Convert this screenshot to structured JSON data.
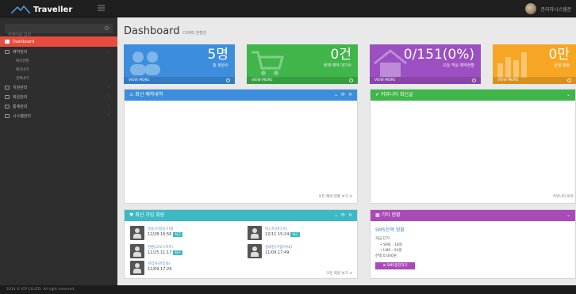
{
  "topbar": {
    "brand": "Traveller",
    "user_name": "관리자시스템관"
  },
  "sidebar": {
    "search_placeholder": "주제어를 입력",
    "items": [
      {
        "label": "Dashboard",
        "icon": "home-icon"
      },
      {
        "label": "예약관리",
        "icon": "calendar-icon"
      },
      {
        "label": "지원관리",
        "icon": "monitor-icon"
      },
      {
        "label": "회원관리",
        "icon": "user-icon"
      },
      {
        "label": "통계관리",
        "icon": "chart-icon"
      },
      {
        "label": "시스템관리",
        "icon": "settings-icon"
      }
    ],
    "subitems": [
      "예약현황",
      "예약내역",
      "결제내역"
    ]
  },
  "page": {
    "title": "Dashboard",
    "subtitle": "CRMS 현황판"
  },
  "stats": [
    {
      "value": "5명",
      "label": "총 회원수",
      "link": "VIEW MORE",
      "color": "#3c8ddc",
      "icon": "users-icon"
    },
    {
      "value": "0건",
      "label": "현재 예약 대기수",
      "link": "VIEW MORE",
      "color": "#3fb54a",
      "icon": "cart-icon"
    },
    {
      "value": "0/151(0%)",
      "label": "오늘 객실 예약현황",
      "link": "VIEW MORE",
      "color": "#9c4fc0",
      "icon": "house-icon"
    },
    {
      "value": "0만",
      "label": "금월 매출",
      "link": "VIEW MORE",
      "color": "#f6a623",
      "icon": "bars-icon"
    }
  ],
  "panels": {
    "reservations": {
      "title": "최신 예약내역",
      "link": "모든 예약 현황 보기",
      "color": "#3c8ddc"
    },
    "community": {
      "title": "커뮤니티 최신글",
      "link": "커뮤니티 바로",
      "color": "#3fb54a"
    },
    "members": {
      "title": "최신 가입 회원",
      "link": "모든 회원 보기",
      "color": "#3db8c4"
    },
    "other": {
      "title": "기타 현황",
      "color": "#a84ab8",
      "sms_title": "SMS잔액 현황",
      "unit_label": "과금 단가",
      "sms_rate": "SMS : 18원",
      "lms_rate": "LMS : 50원",
      "balance": "잔액:0,000원",
      "button": "SMS충전하기"
    }
  },
  "members": [
    {
      "name": "정승구(정승구대)",
      "date": "12/28 16:56",
      "badge": "최근"
    },
    {
      "name": "테스트(테스트)",
      "date": "12/11 15:24",
      "badge": "최근"
    },
    {
      "name": "한환(고모스프트)",
      "date": "11/25 11:17",
      "badge": "최근"
    },
    {
      "name": "강태진(기업/이내)",
      "date": "11/09 17:49",
      "badge": ""
    },
    {
      "name": "관리자(관리자)",
      "date": "11/09 17:29",
      "badge": ""
    }
  ],
  "footer": {
    "copyright": "2014 © ICP CO.LTD. All right reserved."
  }
}
